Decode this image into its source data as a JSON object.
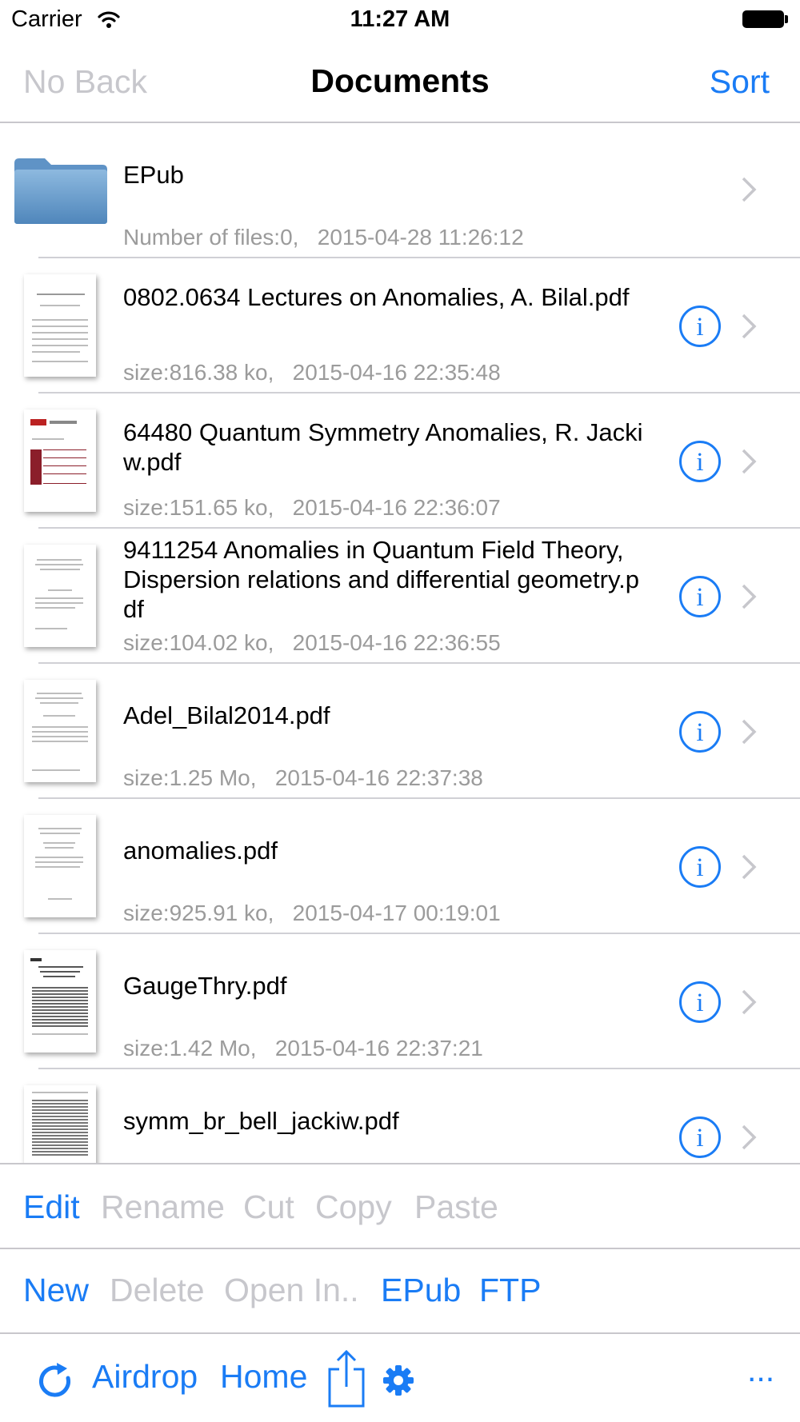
{
  "status": {
    "carrier": "Carrier",
    "time": "11:27 AM"
  },
  "nav": {
    "back": "No Back",
    "title": "Documents",
    "sort": "Sort"
  },
  "rows": [
    {
      "type": "folder",
      "title": "EPub",
      "meta": "Number of files:0,   2015-04-28 11:26:12"
    },
    {
      "type": "pdf",
      "title": "0802.0634 Lectures on Anomalies, A. Bilal.pdf",
      "meta": "size:816.38 ko,   2015-04-16 22:35:48"
    },
    {
      "type": "pdf",
      "title": "64480 Quantum Symmetry Anomalies, R. Jackiw.pdf",
      "meta": "size:151.65 ko,   2015-04-16 22:36:07"
    },
    {
      "type": "pdf",
      "title": "9411254 Anomalies in Quantum Field Theory, Dispersion relations and differential geometry.pdf",
      "meta": "size:104.02 ko,   2015-04-16 22:36:55"
    },
    {
      "type": "pdf",
      "title": "Adel_Bilal2014.pdf",
      "meta": "size:1.25 Mo,   2015-04-16 22:37:38"
    },
    {
      "type": "pdf",
      "title": "anomalies.pdf",
      "meta": "size:925.91 ko,   2015-04-17 00:19:01"
    },
    {
      "type": "pdf",
      "title": "GaugeThry.pdf",
      "meta": "size:1.42 Mo,   2015-04-16 22:37:21"
    },
    {
      "type": "pdf",
      "title": "symm_br_bell_jackiw.pdf",
      "meta": ""
    }
  ],
  "toolbar1": [
    {
      "label": "Edit",
      "enabled": true
    },
    {
      "label": "Rename",
      "enabled": false
    },
    {
      "label": "Cut",
      "enabled": false
    },
    {
      "label": "Copy",
      "enabled": false
    },
    {
      "label": "Paste",
      "enabled": false
    }
  ],
  "toolbar2": [
    {
      "label": "New",
      "enabled": true
    },
    {
      "label": "Delete",
      "enabled": false
    },
    {
      "label": "Open In..",
      "enabled": false
    },
    {
      "label": "EPub",
      "enabled": true
    },
    {
      "label": "FTP",
      "enabled": true
    }
  ],
  "toolbar3": {
    "refresh_icon": "refresh-icon",
    "airdrop": "Airdrop",
    "home": "Home",
    "share_icon": "share-icon",
    "settings_icon": "gear-icon",
    "more": "..."
  },
  "colors": {
    "accent": "#1a7cf5",
    "disabled": "#c7c7cc",
    "meta": "#9b9b9b",
    "separator": "#c8c7cc"
  }
}
